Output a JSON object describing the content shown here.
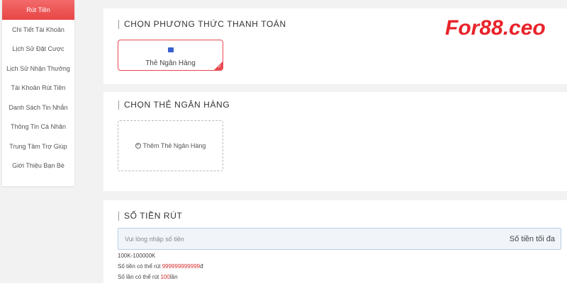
{
  "sidebar": {
    "items": [
      {
        "label": "Rút Tiền",
        "active": true
      },
      {
        "label": "Chi Tiết Tài Khoản"
      },
      {
        "label": "Lịch Sử Đặt Cược"
      },
      {
        "label": "Lịch Sử Nhận Thưởng"
      },
      {
        "label": "Tài Khoản Rút Tiền"
      },
      {
        "label": "Danh Sách Tin Nhắn"
      },
      {
        "label": "Thông Tin Cá Nhân"
      },
      {
        "label": "Trung Tâm Trợ Giúp"
      },
      {
        "label": "Giới Thiệu Bạn Bè"
      }
    ]
  },
  "payment_method": {
    "title": "CHỌN PHƯƠNG THỨC THANH TOÁN",
    "card_label": "Thẻ Ngân Hàng",
    "card_icon": "bank-card-icon",
    "selected": true
  },
  "bank_select": {
    "title": "CHỌN THẺ NGÂN HÀNG",
    "add_label": "Thêm Thẻ Ngân Hàng",
    "add_icon": "plus-circle-icon"
  },
  "amount": {
    "title": "SỐ TIỀN RÚT",
    "placeholder": "Vui lòng nhập số tiền",
    "max_label": "Số tiền tối đa",
    "range": "100K-100000K",
    "withdrawable_prefix": "Số tiền có thể rút ",
    "withdrawable_value": "999999999999",
    "withdrawable_suffix": "đ",
    "times_prefix": "Số lần có thể rút ",
    "times_value": "100",
    "times_suffix": "lần"
  },
  "logo": {
    "text": "For88.ceo"
  },
  "colors": {
    "accent": "#e8484f",
    "brand": "#e8232a",
    "input_bg": "#f1f5fa"
  }
}
